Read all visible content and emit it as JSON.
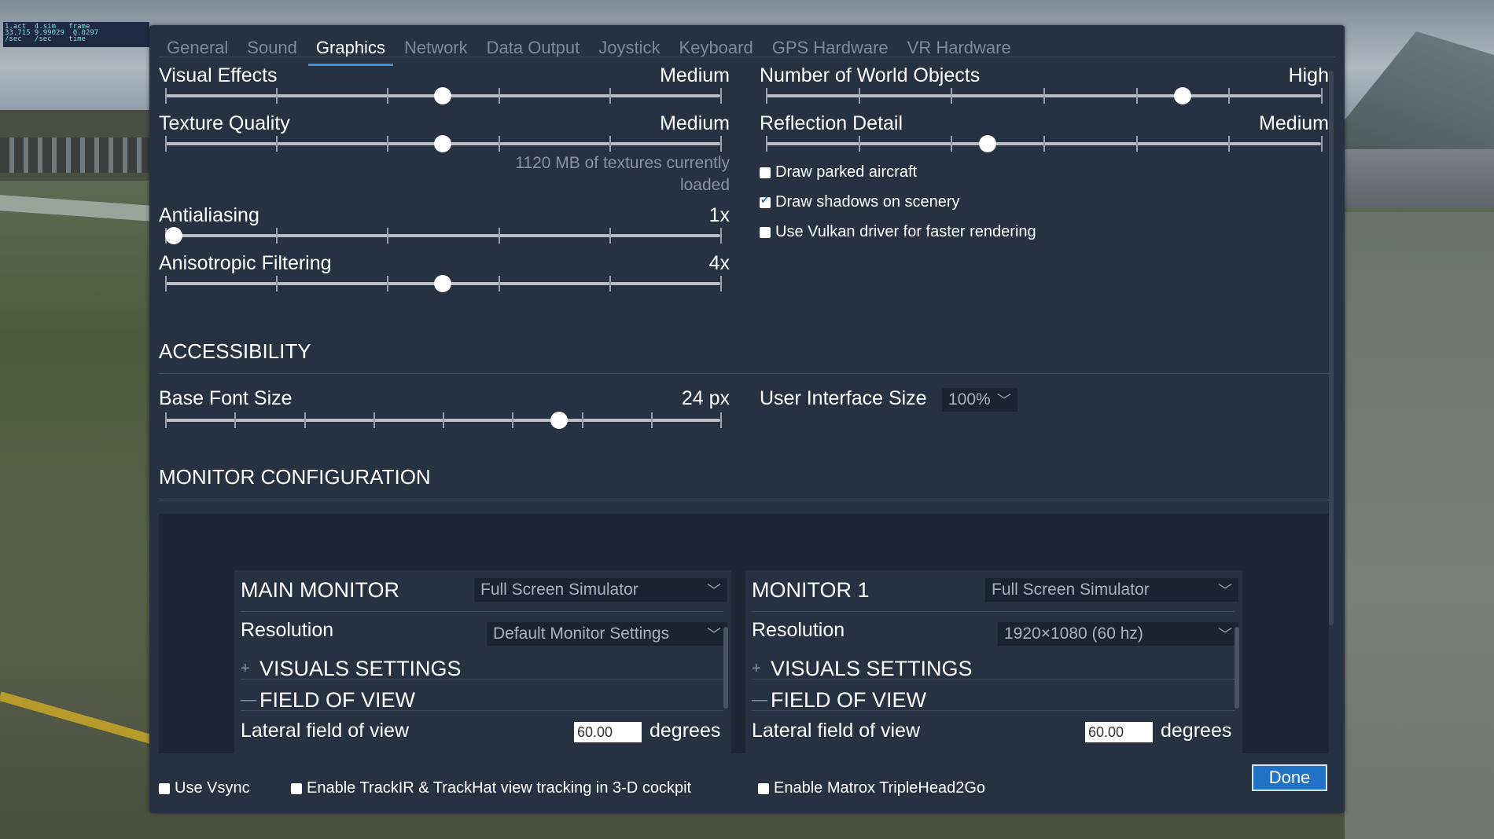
{
  "hud": {
    "text": "1.act  4.sim   frame\n33.715 9.99029  0.0297\n/sec   /sec    time"
  },
  "tabs": [
    "General",
    "Sound",
    "Graphics",
    "Network",
    "Data Output",
    "Joystick",
    "Keyboard",
    "GPS Hardware",
    "VR Hardware"
  ],
  "active_tab": "Graphics",
  "graphics": {
    "visual_effects": {
      "label": "Visual Effects",
      "value": "Medium",
      "level": 0.5
    },
    "texture_quality": {
      "label": "Texture Quality",
      "value": "Medium",
      "level": 0.5,
      "note": "1120 MB of textures currently loaded"
    },
    "antialiasing": {
      "label": "Antialiasing",
      "value": "1x",
      "level": 0.0
    },
    "anisotropic": {
      "label": "Anisotropic Filtering",
      "value": "4x",
      "level": 0.5
    },
    "world_objects": {
      "label": "Number of World Objects",
      "value": "High",
      "level": 0.75
    },
    "reflection": {
      "label": "Reflection Detail",
      "value": "Medium",
      "level": 0.4
    },
    "checkboxes": [
      {
        "label": "Draw parked aircraft",
        "checked": false
      },
      {
        "label": "Draw shadows on scenery",
        "checked": true
      },
      {
        "label": "Use Vulkan driver for faster rendering",
        "checked": false
      }
    ]
  },
  "accessibility": {
    "title": "ACCESSIBILITY",
    "base_font": {
      "label": "Base Font Size",
      "value": "24 px",
      "level": 0.71
    },
    "ui_size": {
      "label": "User Interface Size",
      "value": "100%"
    }
  },
  "monitor_config": {
    "title": "MONITOR CONFIGURATION",
    "main": {
      "title": "MAIN MONITOR",
      "mode": "Full Screen Simulator",
      "resolution_label": "Resolution",
      "resolution": "Default Monitor Settings",
      "visuals": "VISUALS SETTINGS",
      "fov": "FIELD OF VIEW",
      "lateral_label": "Lateral field of view",
      "lateral_value": "60.00",
      "unit": "degrees"
    },
    "mon1": {
      "title": "MONITOR 1",
      "mode": "Full Screen Simulator",
      "resolution_label": "Resolution",
      "resolution": "1920×1080 (60 hz)",
      "visuals": "VISUALS SETTINGS",
      "fov": "FIELD OF VIEW",
      "lateral_label": "Lateral field of view",
      "lateral_value": "60.00",
      "unit": "degrees"
    }
  },
  "footer": {
    "vsync": {
      "label": "Use Vsync",
      "checked": false
    },
    "trackir": {
      "label": "Enable TrackIR & TrackHat view tracking in 3-D cockpit",
      "checked": false
    },
    "matrox": {
      "label": "Enable Matrox TripleHead2Go",
      "checked": false
    },
    "done": "Done"
  },
  "colors": {
    "accent": "#3d8fd6",
    "panel": "#263242",
    "done": "#1f72c4"
  }
}
